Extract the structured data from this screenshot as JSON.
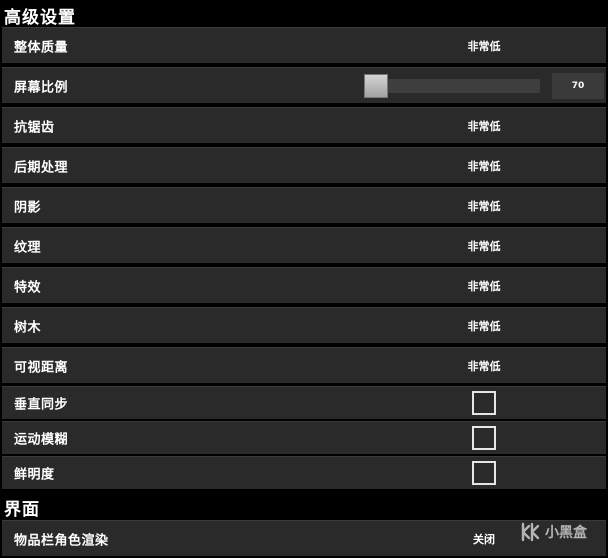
{
  "sections": {
    "advanced": "高级设置",
    "interface": "界面"
  },
  "rows": {
    "overall_quality": {
      "label": "整体质量",
      "value": "非常低"
    },
    "screen_ratio": {
      "label": "屏幕比例",
      "value": "70",
      "level": 0.0
    },
    "antialiasing": {
      "label": "抗锯齿",
      "value": "非常低"
    },
    "post_processing": {
      "label": "后期处理",
      "value": "非常低"
    },
    "shadows": {
      "label": "阴影",
      "value": "非常低"
    },
    "textures": {
      "label": "纹理",
      "value": "非常低"
    },
    "effects": {
      "label": "特效",
      "value": "非常低"
    },
    "trees": {
      "label": "树木",
      "value": "非常低"
    },
    "view_distance": {
      "label": "可视距离",
      "value": "非常低"
    },
    "vsync": {
      "label": "垂直同步",
      "checked": false
    },
    "motion_blur": {
      "label": "运动模糊",
      "checked": false
    },
    "vibrancy": {
      "label": "鲜明度",
      "checked": false
    },
    "inventory_render": {
      "label": "物品栏角色渲染",
      "value": "关闭"
    }
  },
  "watermark": {
    "text": "小黑盒",
    "icon": "heybox-logo-icon"
  },
  "colors": {
    "background": "#000000",
    "row_bg": "#2a2a2a",
    "slider_track": "#3e3e3e",
    "text": "#ffffff"
  }
}
